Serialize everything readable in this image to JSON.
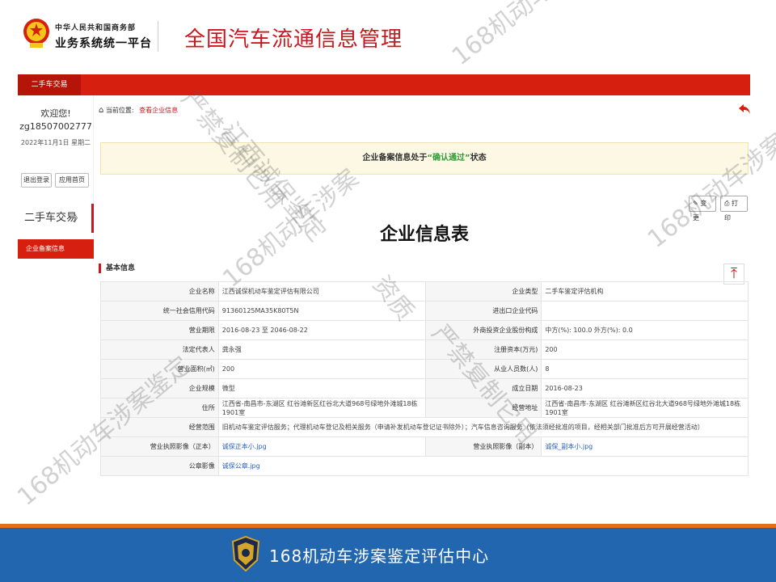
{
  "header": {
    "org_line1": "中华人民共和国商务部",
    "org_line2": "业务系统统一平台",
    "site_title": "全国汽车流通信息管理"
  },
  "topnav": {
    "item": "二手车交易"
  },
  "sidebar": {
    "welcome": "欢迎您!",
    "username": "zg18507002777",
    "date": "2022年11月1日 星期二",
    "logout": "退出登录",
    "home": "应用首页",
    "menu_group": "二手车交易",
    "menu_group_chevron": "〉",
    "menu_sub": "企业备案信息"
  },
  "breadcrumb": {
    "prefix": "当前位置:",
    "current": "查看企业信息"
  },
  "notice": {
    "before": "企业备案信息处于",
    "status": "“确认通过”",
    "after": "状态"
  },
  "actions": {
    "edit": "变更",
    "print": "打印"
  },
  "form_title": "企业信息表",
  "section": "基本信息",
  "totop_glyph": "⤒",
  "table": {
    "rows": [
      {
        "l1": "企业名称",
        "v1": "江西诚保机动车鉴定评估有限公司",
        "l2": "企业类型",
        "v2": "二手车鉴定评估机构"
      },
      {
        "l1": "统一社会信用代码",
        "v1": "91360125MA35K80T5N",
        "l2": "进出口企业代码",
        "v2": ""
      },
      {
        "l1": "营业期限",
        "v1": "2016-08-23 至 2046-08-22",
        "l2": "外商投资企业股份构成",
        "v2": "中方(%): 100.0 外方(%): 0.0"
      },
      {
        "l1": "法定代表人",
        "v1": "龚永强",
        "l2": "注册资本(万元)",
        "v2": "200"
      },
      {
        "l1": "营业面积(㎡)",
        "v1": "200",
        "l2": "从业人员数(人)",
        "v2": "8"
      },
      {
        "l1": "企业规模",
        "v1": "微型",
        "l2": "成立日期",
        "v2": "2016-08-23"
      },
      {
        "l1": "住所",
        "v1": "江西省-南昌市-东湖区 红谷滩新区红谷北大道968号绿地外滩城18栋1901室",
        "l2": "经营地址",
        "v2": "江西省-南昌市-东湖区 红谷滩新区红谷北大道968号绿地外滩城18栋1901室"
      }
    ],
    "scope_label": "经营范围",
    "scope_value": "旧机动车鉴定评估服务；代理机动车登记及相关服务（申请补发机动车登记证书除外）；汽车信息咨询服务（依法须经批准的项目，经相关部门批准后方可开展经营活动）",
    "license_main_label": "营业执照影像（正本）",
    "license_main_value": "诚保正本小.jpg",
    "license_copy_label": "营业执照影像（副本）",
    "license_copy_value": "诚保_副本小.jpg",
    "seal_label": "公章影像",
    "seal_value": "诚保公章.jpg"
  },
  "footer": {
    "text": "168机动车涉案鉴定评估中心"
  },
  "watermark": {
    "w1": "168机动车涉案鉴定",
    "w2": "严禁复制它用",
    "w3": "江西诚保鉴定",
    "w4": "168机动车涉案",
    "w5": "资质",
    "w6": "168机动车涉案鉴定",
    "w7": "严禁复制它用",
    "w8": "168机动车涉案鉴定"
  },
  "colors": {
    "brand_red": "#d71f10",
    "notice_green": "#2e9a38",
    "footer_blue": "#2366b0",
    "footer_stripe": "#e96f16"
  }
}
